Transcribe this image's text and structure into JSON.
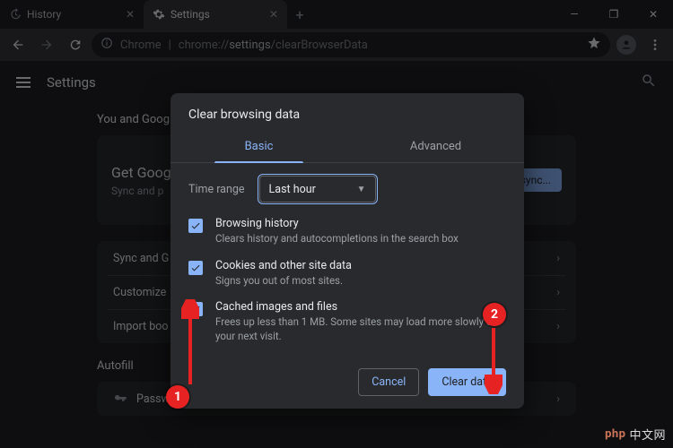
{
  "window": {
    "tabs": [
      {
        "label": "History",
        "icon": "history"
      },
      {
        "label": "Settings",
        "icon": "gear"
      }
    ],
    "controls": {
      "min": "—",
      "max": "❐",
      "close": "✕"
    }
  },
  "toolbar": {
    "secure_label": "Chrome",
    "url_prefix": "chrome://",
    "url_bold": "settings",
    "url_rest": "/clearBrowserData"
  },
  "settings": {
    "app_title": "Settings",
    "sections": {
      "you": "You and Google",
      "autofill": "Autofill"
    },
    "card1": {
      "title": "Get Google smarts in Chrome",
      "title_short": "Get Google",
      "sub": "Sync and personalize Chrome across your devices",
      "sub_short": "Sync and p",
      "button": "Turn on sync...",
      "button_short": "n sync..."
    },
    "rows": {
      "sync": "Sync and Google services",
      "sync_short": "Sync and G",
      "customize": "Customize your Chrome profile",
      "customize_short": "Customize",
      "import": "Import bookmarks and settings",
      "import_short": "Import boo",
      "passwords": "Passwords"
    }
  },
  "dialog": {
    "title": "Clear browsing data",
    "tabs": {
      "basic": "Basic",
      "advanced": "Advanced"
    },
    "time_label": "Time range",
    "time_value": "Last hour",
    "items": [
      {
        "title": "Browsing history",
        "desc": "Clears history and autocompletions in the search box"
      },
      {
        "title": "Cookies and other site data",
        "desc": "Signs you out of most sites."
      },
      {
        "title": "Cached images and files",
        "desc": "Frees up less than 1 MB. Some sites may load more slowly on your next visit."
      }
    ],
    "cancel": "Cancel",
    "confirm": "Clear data"
  },
  "annotations": {
    "marker1": "1",
    "marker2": "2"
  },
  "watermark": {
    "text": "中文网",
    "brand": "php"
  }
}
